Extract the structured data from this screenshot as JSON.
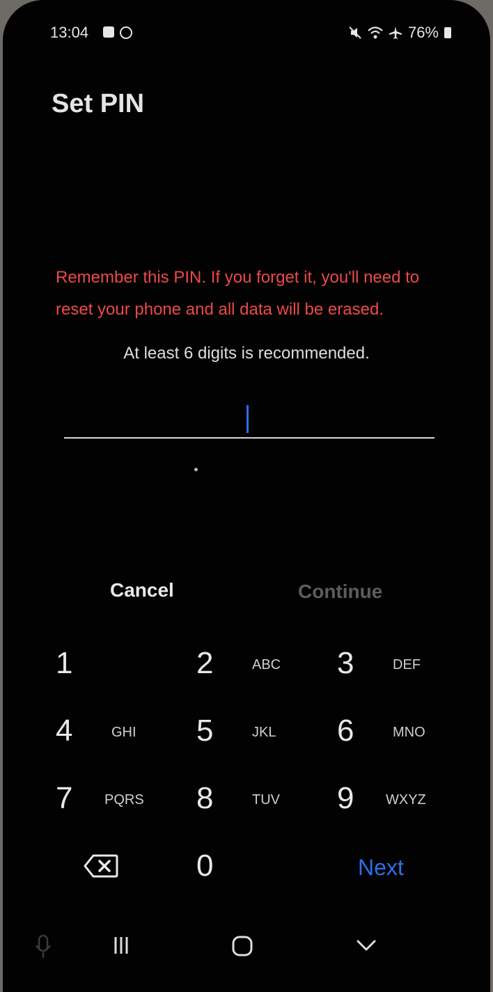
{
  "status": {
    "time": "13:04",
    "battery": "76%",
    "left_icons": [
      "screen-record-icon",
      "app-circle-icon"
    ],
    "right_icons": [
      "mute-icon",
      "wifi-icon",
      "airplane-icon",
      "battery-icon"
    ]
  },
  "page": {
    "title": "Set PIN",
    "warning": "Remember this PIN. If you forget it, you'll need to reset your phone and all data will be erased.",
    "hint": "At least 6 digits is recommended.",
    "pin_value": ""
  },
  "actions": {
    "cancel": "Cancel",
    "continue": "Continue"
  },
  "keypad": {
    "keys": [
      {
        "num": "1",
        "letters": ""
      },
      {
        "num": "2",
        "letters": "ABC"
      },
      {
        "num": "3",
        "letters": "DEF"
      },
      {
        "num": "4",
        "letters": "GHI"
      },
      {
        "num": "5",
        "letters": "JKL"
      },
      {
        "num": "6",
        "letters": "MNO"
      },
      {
        "num": "7",
        "letters": "PQRS"
      },
      {
        "num": "8",
        "letters": "TUV"
      },
      {
        "num": "9",
        "letters": "WXYZ"
      },
      {
        "num": "0",
        "letters": ""
      }
    ],
    "next": "Next",
    "backspace_icon": "backspace-icon"
  },
  "navbar": {
    "icons": [
      "mic-icon",
      "recents-icon",
      "home-icon",
      "back-icon"
    ]
  },
  "colors": {
    "warning": "#ec4a48",
    "accent": "#2f6ee8",
    "background": "#020202"
  }
}
